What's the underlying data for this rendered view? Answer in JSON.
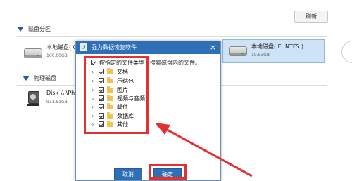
{
  "toolbar": {
    "refresh_label": "刷新"
  },
  "disk_partition": {
    "heading": "磁盘分区",
    "disks": [
      {
        "name": "本地磁盘( C:",
        "size": "100.00GB"
      },
      {
        "name": "本地磁盘( E: NTFS )",
        "size": "19.53GB",
        "selected": true
      }
    ]
  },
  "physical_disk": {
    "heading": "物理磁盘",
    "disks": [
      {
        "name": "Disk \\\\.\\Phy",
        "size": "931.51GB"
      }
    ]
  },
  "dialog": {
    "title": "强力数据恢复软件",
    "close_label": "×",
    "root_item": {
      "label": "按指定的文件类型",
      "hint": "搜索磁盘内的文件。"
    },
    "file_types": [
      "文档",
      "压缩包",
      "图片",
      "视频与音频",
      "邮件",
      "数据库",
      "其他"
    ],
    "cancel_label": "取消",
    "ok_label": "确定"
  },
  "colors": {
    "accent": "#2f6fb7",
    "highlight": "#e53030",
    "selected_bg": "#cfe3f7"
  }
}
